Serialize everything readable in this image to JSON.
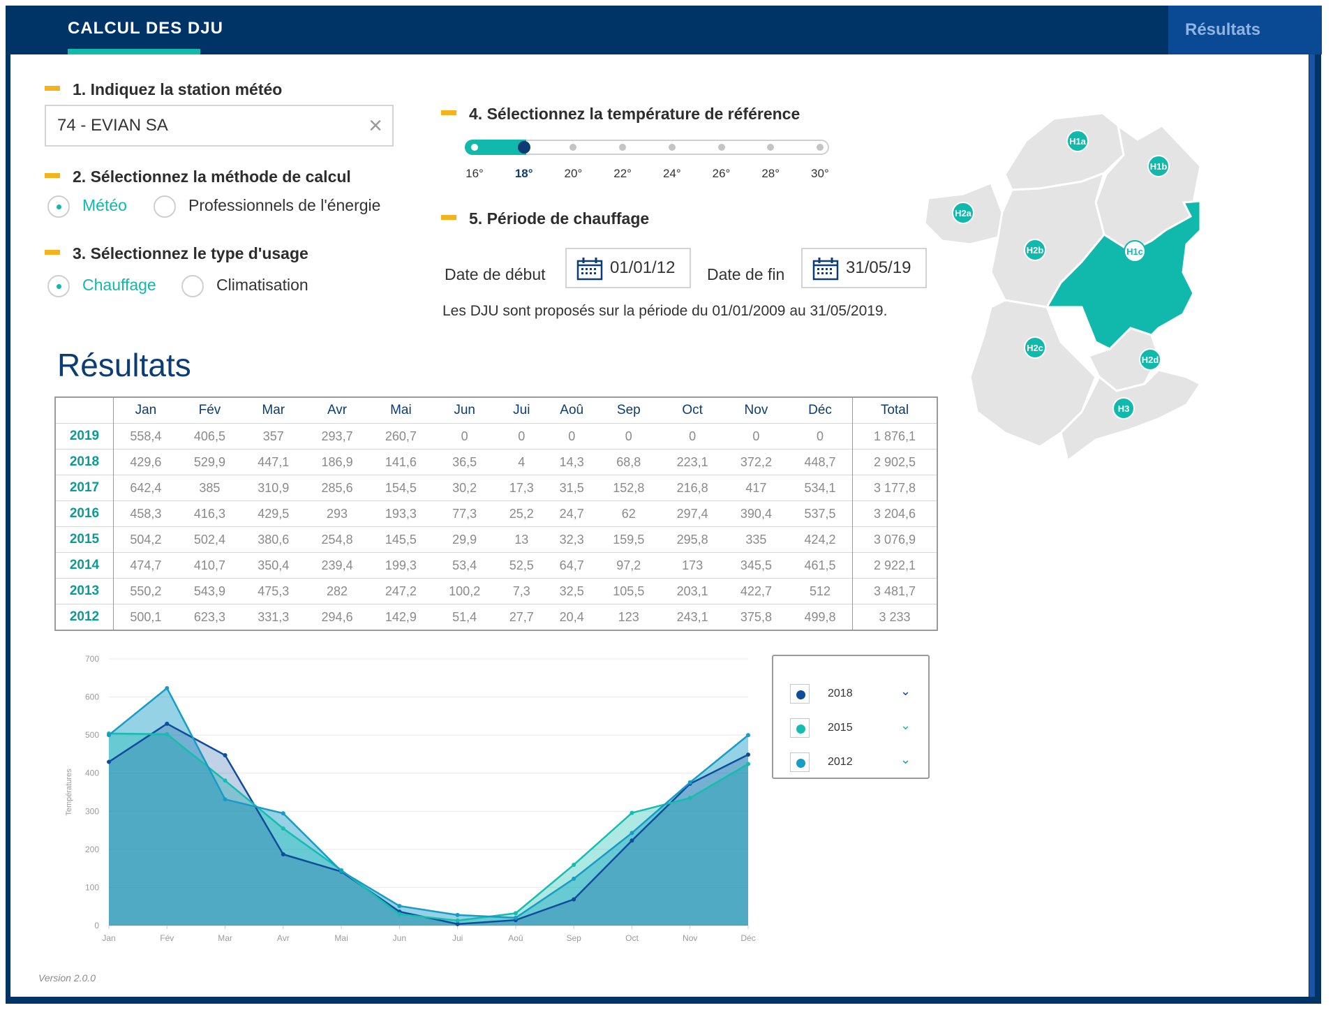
{
  "header": {
    "title": "CALCUL DES DJU",
    "results_tab": "Résultats"
  },
  "steps": {
    "s1": "1. Indiquez la station météo",
    "s2": "2. Sélectionnez la méthode de calcul",
    "s3": "3. Sélectionnez le type d'usage",
    "s4": "4. Sélectionnez la température de référence",
    "s5": "5. Période de chauffage"
  },
  "station": {
    "value": "74 - EVIAN SA",
    "clear_icon": "×"
  },
  "method": {
    "options": [
      "Météo",
      "Professionnels de l'énergie"
    ],
    "selected": "Météo"
  },
  "usage": {
    "options": [
      "Chauffage",
      "Climatisation"
    ],
    "selected": "Chauffage"
  },
  "temperature": {
    "ticks": [
      "16°",
      "18°",
      "20°",
      "22°",
      "24°",
      "26°",
      "28°",
      "30°"
    ],
    "selected": "18°"
  },
  "period": {
    "start_label": "Date de début",
    "start_value": "01/01/12",
    "end_label": "Date de fin",
    "end_value": "31/05/19",
    "note": "Les DJU sont proposés sur la période  du 01/01/2009 au 31/05/2019."
  },
  "results": {
    "title": "Résultats",
    "columns": [
      "Jan",
      "Fév",
      "Mar",
      "Avr",
      "Mai",
      "Jun",
      "Jui",
      "Aoû",
      "Sep",
      "Oct",
      "Nov",
      "Déc",
      "Total"
    ],
    "rows": [
      {
        "year": "2019",
        "values": [
          "558,4",
          "406,5",
          "357",
          "293,7",
          "260,7",
          "0",
          "0",
          "0",
          "0",
          "0",
          "0",
          "0"
        ],
        "total": "1 876,1"
      },
      {
        "year": "2018",
        "values": [
          "429,6",
          "529,9",
          "447,1",
          "186,9",
          "141,6",
          "36,5",
          "4",
          "14,3",
          "68,8",
          "223,1",
          "372,2",
          "448,7"
        ],
        "total": "2 902,5"
      },
      {
        "year": "2017",
        "values": [
          "642,4",
          "385",
          "310,9",
          "285,6",
          "154,5",
          "30,2",
          "17,3",
          "31,5",
          "152,8",
          "216,8",
          "417",
          "534,1"
        ],
        "total": "3 177,8"
      },
      {
        "year": "2016",
        "values": [
          "458,3",
          "416,3",
          "429,5",
          "293",
          "193,3",
          "77,3",
          "25,2",
          "24,7",
          "62",
          "297,4",
          "390,4",
          "537,5"
        ],
        "total": "3 204,6"
      },
      {
        "year": "2015",
        "values": [
          "504,2",
          "502,4",
          "380,6",
          "254,8",
          "145,5",
          "29,9",
          "13",
          "32,3",
          "159,5",
          "295,8",
          "335",
          "424,2"
        ],
        "total": "3 076,9"
      },
      {
        "year": "2014",
        "values": [
          "474,7",
          "410,7",
          "350,4",
          "239,4",
          "199,3",
          "53,4",
          "52,5",
          "64,7",
          "97,2",
          "173",
          "345,5",
          "461,5"
        ],
        "total": "2 922,1"
      },
      {
        "year": "2013",
        "values": [
          "550,2",
          "543,9",
          "475,3",
          "282",
          "247,2",
          "100,2",
          "7,3",
          "32,5",
          "105,5",
          "203,1",
          "422,7",
          "512"
        ],
        "total": "3 481,7"
      },
      {
        "year": "2012",
        "values": [
          "500,1",
          "623,3",
          "331,3",
          "294,6",
          "142,9",
          "51,4",
          "27,7",
          "20,4",
          "123",
          "243,1",
          "375,8",
          "499,8"
        ],
        "total": "3 233"
      }
    ]
  },
  "chart_data": {
    "type": "area",
    "categories": [
      "Jan",
      "Fév",
      "Mar",
      "Avr",
      "Mai",
      "Jun",
      "Jui",
      "Aoû",
      "Sep",
      "Oct",
      "Nov",
      "Déc"
    ],
    "ylabel": "Températures",
    "ylim": [
      0,
      700
    ],
    "yticks": [
      0,
      100,
      200,
      300,
      400,
      500,
      600,
      700
    ],
    "grid": true,
    "legend_position": "right",
    "series": [
      {
        "name": "2018",
        "color": "#0d4d9c",
        "values": [
          429.6,
          529.9,
          447.1,
          186.9,
          141.6,
          36.5,
          4,
          14.3,
          68.8,
          223.1,
          372.2,
          448.7
        ]
      },
      {
        "name": "2015",
        "color": "#14bdb0",
        "values": [
          504.2,
          502.4,
          380.6,
          254.8,
          145.5,
          29.9,
          13,
          32.3,
          159.5,
          295.8,
          335,
          424.2
        ]
      },
      {
        "name": "2012",
        "color": "#179cc6",
        "values": [
          500.1,
          623.3,
          331.3,
          294.6,
          142.9,
          51.4,
          27.7,
          20.4,
          123,
          243.1,
          375.8,
          499.8
        ]
      }
    ]
  },
  "map": {
    "zones": [
      "H1a",
      "H1b",
      "H1c",
      "H2a",
      "H2b",
      "H2c",
      "H2d",
      "H3"
    ],
    "selected": "H1c",
    "selected_color": "#10b9ab",
    "base_color": "#e4e4e4"
  },
  "footer": {
    "version": "Version 2.0.0"
  }
}
